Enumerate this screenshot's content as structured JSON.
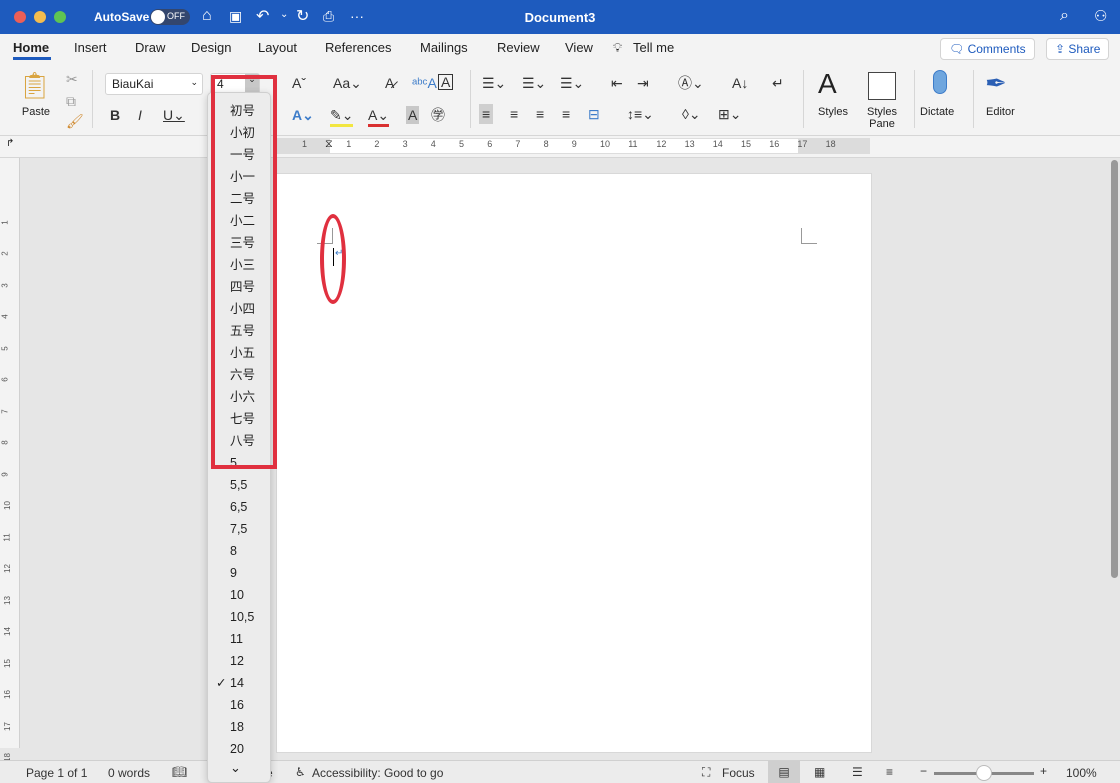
{
  "window": {
    "title": "Document3",
    "autosave_label": "AutoSave",
    "autosave_state": "OFF",
    "more": "···"
  },
  "tabs": [
    "Home",
    "Insert",
    "Draw",
    "Design",
    "Layout",
    "References",
    "Mailings",
    "Review",
    "View"
  ],
  "tell_me": "Tell me",
  "comments_label": "Comments",
  "share_label": "Share",
  "ribbon": {
    "paste": "Paste",
    "font_name": "BiauKai",
    "font_size": "4",
    "styles": "Styles",
    "styles_pane": "Styles Pane",
    "dictate": "Dictate",
    "editor": "Editor"
  },
  "ruler_numbers": [
    "1",
    "1",
    "2",
    "3",
    "4",
    "5",
    "6",
    "7",
    "8",
    "9",
    "10",
    "11",
    "12",
    "13",
    "14",
    "15",
    "16",
    "17",
    "18"
  ],
  "font_size_options": [
    "初号",
    "小初",
    "一号",
    "小一",
    "二号",
    "小二",
    "三号",
    "小三",
    "四号",
    "小四",
    "五号",
    "小五",
    "六号",
    "小六",
    "七号",
    "八号",
    "5",
    "5,5",
    "6,5",
    "7,5",
    "8",
    "9",
    "10",
    "10,5",
    "11",
    "12",
    "14",
    "16",
    "18",
    "20"
  ],
  "selected_size": "14",
  "checkmark": "✓",
  "status": {
    "page": "Page 1 of 1",
    "words": "0 words",
    "hidden_text": "e",
    "accessibility": "Accessibility: Good to go",
    "focus": "Focus",
    "zoom": "100%"
  },
  "annotation_color": "#e0303f",
  "accent": "#1e5bbe"
}
